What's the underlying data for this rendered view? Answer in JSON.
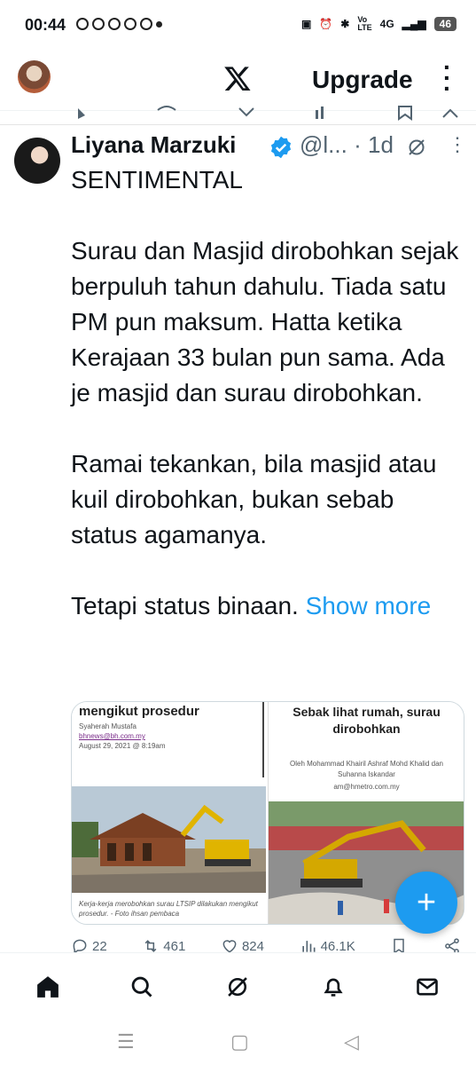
{
  "status_bar": {
    "time": "00:44",
    "network": "4G",
    "battery": "46"
  },
  "header": {
    "upgrade_label": "Upgrade"
  },
  "tweet": {
    "display_name": "Liyana Marzuki",
    "handle": "@l...",
    "separator": "·",
    "time": "1d",
    "text": "SENTIMENTAL\n\nSurau dan Masjid dirobohkan sejak berpuluh tahun dahulu. Tiada satu PM pun maksum. Hatta ketika Kerajaan 33 bulan pun sama. Ada je masjid dan surau dirobohkan.\n\nRamai tekankan, bila masjid atau kuil dirobohkan, bukan sebab status agamanya.\n\nTetapi status binaan. ",
    "show_more": "Show more",
    "media": {
      "left": {
        "headline": "mengikut prosedur",
        "author": "Syaherah Mustafa",
        "email": "bhnews@bh.com.my",
        "date": "August 29, 2021 @ 8:19am",
        "caption": "Kerja-kerja merobohkan surau LTSIP dilakukan mengikut prosedur. - Foto ihsan pembaca"
      },
      "right": {
        "headline": "Sebak lihat rumah, surau dirobohkan",
        "byline": "Oleh Mohammad Khairil Ashraf Mohd Khalid dan Suhanna Iskandar",
        "email": "am@hmetro.com.my"
      }
    },
    "stats": {
      "replies": "22",
      "reposts": "461",
      "likes": "824",
      "views": "46.1K"
    }
  },
  "colors": {
    "accent": "#1d9bf0",
    "text": "#0f1419",
    "muted": "#536471"
  }
}
